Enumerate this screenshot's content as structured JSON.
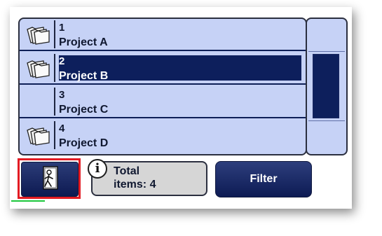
{
  "list": {
    "items": [
      {
        "number": "1",
        "name": "Project A",
        "has_icon": true,
        "selected": false
      },
      {
        "number": "2",
        "name": "Project B",
        "has_icon": true,
        "selected": true
      },
      {
        "number": "3",
        "name": "Project C",
        "has_icon": false,
        "selected": false
      },
      {
        "number": "4",
        "name": "Project D",
        "has_icon": true,
        "selected": false
      }
    ],
    "item_icon": "folders-icon"
  },
  "toolbar": {
    "exit_icon": "exit-door-icon",
    "info_icon": "info-icon",
    "info_glyph": "i",
    "total_line1": "Total",
    "total_line2": "items: 4",
    "filter_label": "Filter"
  },
  "colors": {
    "list_background": "#c6d2f6",
    "selection": "#0d1f5c",
    "button": "#0d1b54",
    "highlight_outline": "#e31b23"
  }
}
